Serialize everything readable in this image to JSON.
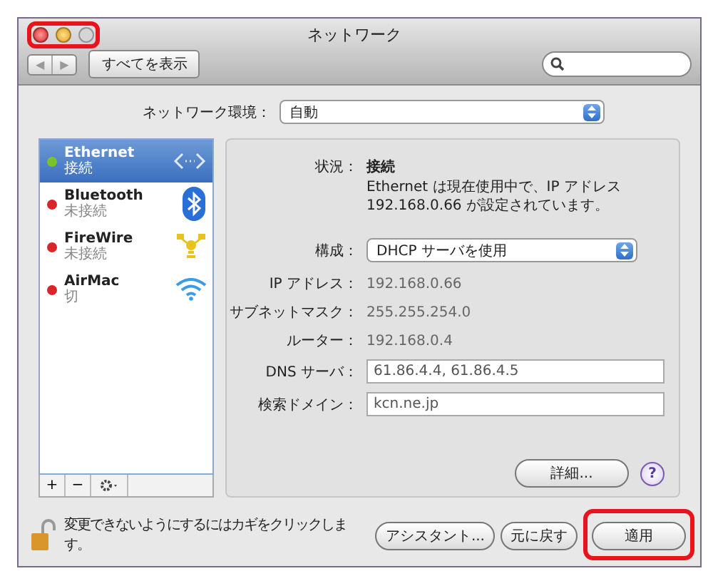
{
  "window": {
    "title": "ネットワーク",
    "close_highlighted": true
  },
  "toolbar": {
    "back": "◀",
    "forward": "▶",
    "show_all": "すべてを表示"
  },
  "location": {
    "label": "ネットワーク環境：",
    "value": "自動"
  },
  "services": [
    {
      "name": "Ethernet",
      "status": "接続",
      "color": "#7cc22a",
      "selected": true,
      "kind": "ethernet"
    },
    {
      "name": "Bluetooth",
      "status": "未接続",
      "color": "#d8262c",
      "selected": false,
      "kind": "bluetooth"
    },
    {
      "name": "FireWire",
      "status": "未接続",
      "color": "#d8262c",
      "selected": false,
      "kind": "firewire"
    },
    {
      "name": "AirMac",
      "status": "切",
      "color": "#d8262c",
      "selected": false,
      "kind": "wifi"
    }
  ],
  "list_buttons": {
    "add": "+",
    "remove": "−"
  },
  "detail": {
    "status_label": "状況：",
    "status_value": "接続",
    "status_description": "Ethernet は現在使用中で、IP アドレス 192.168.0.66 が設定されています。",
    "config_label": "構成：",
    "config_value": "DHCP サーバを使用",
    "fields": [
      {
        "label": "IP アドレス：",
        "value": "192.168.0.66",
        "kind": "text"
      },
      {
        "label": "サブネットマスク：",
        "value": "255.255.254.0",
        "kind": "text"
      },
      {
        "label": "ルーター：",
        "value": "192.168.0.4",
        "kind": "text"
      },
      {
        "label": "DNS サーバ：",
        "value": "61.86.4.4, 61.86.4.5",
        "kind": "input"
      },
      {
        "label": "検索ドメイン：",
        "value": "kcn.ne.jp",
        "kind": "input"
      }
    ],
    "advanced": "詳細...",
    "help": "?"
  },
  "footer": {
    "lock_text": "変更できないようにするにはカギをクリックします。",
    "buttons": [
      {
        "label": "アシスタント...",
        "highlighted": false
      },
      {
        "label": "元に戻す",
        "highlighted": false
      },
      {
        "label": "適用",
        "highlighted": true
      }
    ]
  }
}
